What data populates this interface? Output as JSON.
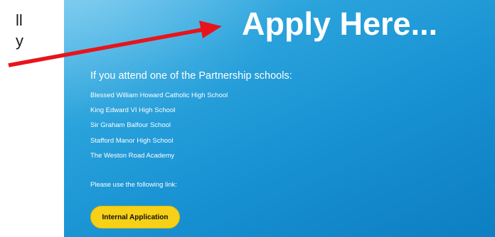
{
  "left_fragments": [
    "ll",
    "y"
  ],
  "panel": {
    "title": "Apply Here...",
    "intro": "If you attend one of the Partnership schools:",
    "schools": [
      "Blessed William Howard Catholic High School",
      "King Edward VI High School",
      "Sir Graham Balfour School",
      "Stafford Manor High School",
      "The Weston Road Academy"
    ],
    "instruction": "Please use the following link:",
    "button_label": "Internal Application"
  },
  "colors": {
    "panel_blue": "#1a93d4",
    "button_yellow": "#f7d117",
    "arrow_red": "#e8141b"
  },
  "icons": {
    "annotation": "red-arrow-icon"
  }
}
